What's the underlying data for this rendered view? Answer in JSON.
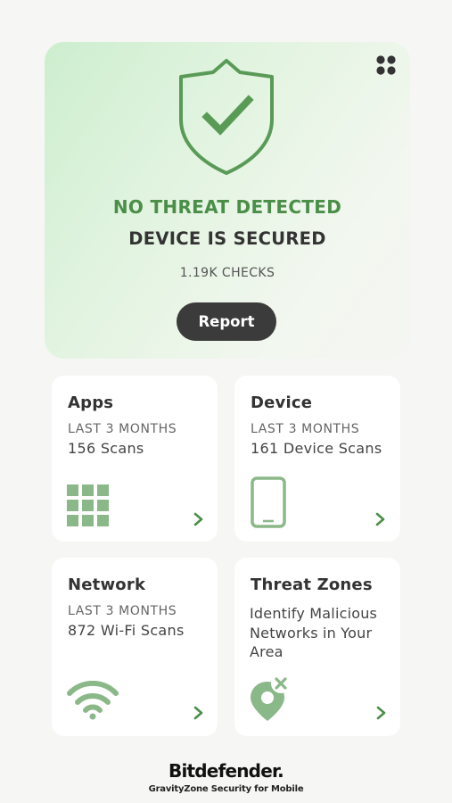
{
  "colors": {
    "accent_green": "#5a9a57",
    "icon_green": "#8bb889",
    "status_green": "#4a8e48",
    "button_dark": "#3b3b3b"
  },
  "hero": {
    "icon": "shield-check-icon",
    "status_title": "NO THREAT DETECTED",
    "status_subtitle": "DEVICE IS SECURED",
    "checks": "1.19K CHECKS",
    "report_label": "Report",
    "menu_icon": "grid-menu-icon"
  },
  "cards": {
    "apps": {
      "title": "Apps",
      "period": "LAST 3 MONTHS",
      "count": "156 Scans",
      "icon": "apps-grid-icon"
    },
    "device": {
      "title": "Device",
      "period": "LAST 3 MONTHS",
      "count": "161 Device Scans",
      "icon": "phone-icon"
    },
    "network": {
      "title": "Network",
      "period": "LAST 3 MONTHS",
      "count": "872 Wi-Fi Scans",
      "icon": "wifi-icon"
    },
    "threat_zones": {
      "title": "Threat Zones",
      "description": "Identify Malicious Networks in Your Area",
      "icon": "location-pin-x-icon"
    }
  },
  "footer": {
    "brand": "Bitdefender.",
    "tagline": "GravityZone Security for Mobile"
  }
}
